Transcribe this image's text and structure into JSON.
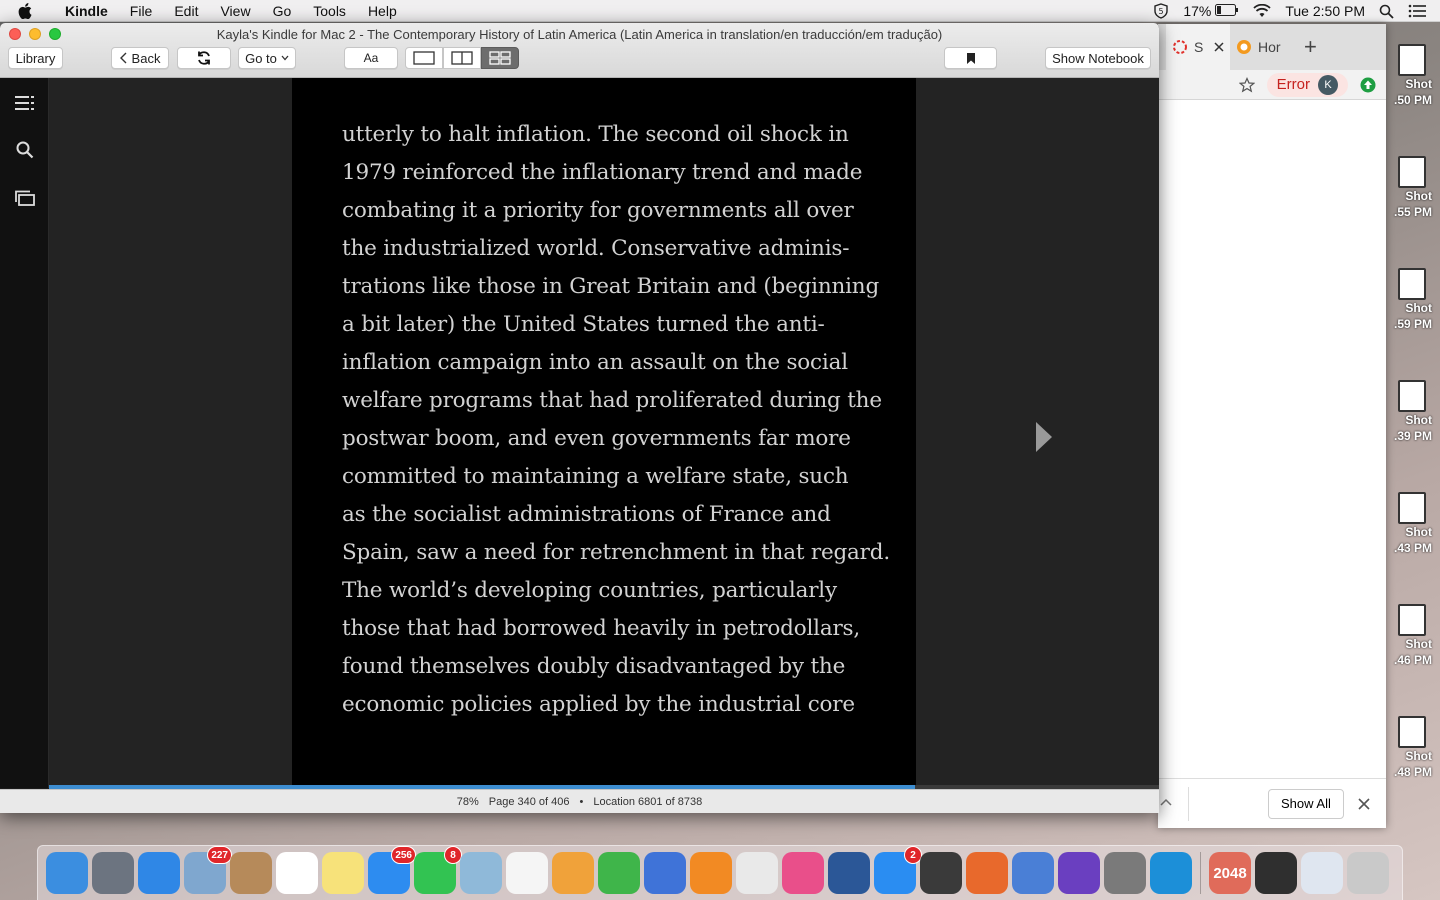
{
  "menubar": {
    "app": "Kindle",
    "menus": [
      "File",
      "Edit",
      "View",
      "Go",
      "Tools",
      "Help"
    ],
    "battery": "17%",
    "clock": "Tue 2:50 PM"
  },
  "desktop": {
    "thumbs": [
      {
        "line1": "Shot",
        "line2": ".50 PM"
      },
      {
        "line1": "Shot",
        "line2": ".55 PM"
      },
      {
        "line1": "Shot",
        "line2": ".59 PM"
      },
      {
        "line1": "Shot",
        "line2": ".39 PM"
      },
      {
        "line1": "Shot",
        "line2": ".43 PM"
      },
      {
        "line1": "Shot",
        "line2": ".46 PM"
      },
      {
        "line1": "Shot",
        "line2": ".48 PM"
      }
    ]
  },
  "chrome": {
    "tab1_label": "S",
    "tab2_label": "Hor",
    "new_tab": "+",
    "error_label": "Error",
    "avatar_letter": "K",
    "show_all": "Show All"
  },
  "kindle": {
    "title": "Kayla's Kindle for Mac 2 - The Contemporary History of Latin America (Latin America in translation/en traducción/em tradução)",
    "toolbar": {
      "library": "Library",
      "back": "Back",
      "goto": "Go to",
      "font": "Aa",
      "show_notebook": "Show Notebook"
    },
    "lines": [
      "utterly to halt inflation. The second oil shock in",
      "1979 reinforced the inflationary trend and made",
      "combating it a priority for governments all over",
      "the industrialized world. Conservative adminis-",
      "trations like those in Great Britain and (beginning",
      "a bit later) the United States turned the anti-",
      "inflation campaign into an assault on the social",
      "welfare programs that had proliferated during the",
      "postwar boom, and even governments far more",
      "committed to maintaining a welfare state, such",
      "as the socialist administrations of France and",
      "Spain, saw a need for retrenchment in that regard.",
      "The world’s developing countries, particularly",
      "those that had borrowed heavily in petrodollars,",
      "found themselves doubly disadvantaged by the",
      "economic policies applied by the industrial core"
    ],
    "progress_fraction": 0.78,
    "status": {
      "percent": "78%",
      "page": "Page 340 of 406",
      "location": "Location 6801 of 8738"
    }
  },
  "dock": {
    "items": [
      {
        "name": "finder",
        "color": "#3b8ee0",
        "badge": ""
      },
      {
        "name": "launchpad",
        "color": "#6c7480",
        "badge": ""
      },
      {
        "name": "safari",
        "color": "#2f87e6",
        "badge": ""
      },
      {
        "name": "mail",
        "color": "#7fa7cf",
        "badge": "227"
      },
      {
        "name": "contacts",
        "color": "#b68a5a",
        "badge": ""
      },
      {
        "name": "calendar",
        "color": "#ffffff",
        "badge": ""
      },
      {
        "name": "notes",
        "color": "#f7e27a",
        "badge": ""
      },
      {
        "name": "messages",
        "color": "#2d8cf0",
        "badge": "256"
      },
      {
        "name": "facetime",
        "color": "#32c352",
        "badge": "8"
      },
      {
        "name": "preview",
        "color": "#8fb9d9",
        "badge": ""
      },
      {
        "name": "photos",
        "color": "#f5f5f5",
        "badge": ""
      },
      {
        "name": "pages",
        "color": "#f0a23a",
        "badge": ""
      },
      {
        "name": "numbers",
        "color": "#3fb54a",
        "badge": ""
      },
      {
        "name": "keynote",
        "color": "#3f73d8",
        "badge": ""
      },
      {
        "name": "ibooks",
        "color": "#f28a23",
        "badge": ""
      },
      {
        "name": "chrome",
        "color": "#e9e9e9",
        "badge": ""
      },
      {
        "name": "itunes",
        "color": "#e94f8a",
        "badge": ""
      },
      {
        "name": "word",
        "color": "#2b5797",
        "badge": ""
      },
      {
        "name": "app-store",
        "color": "#2a8df2",
        "badge": "2"
      },
      {
        "name": "screen-recorder",
        "color": "#3a3a3a",
        "badge": ""
      },
      {
        "name": "firefox",
        "color": "#e8692c",
        "badge": ""
      },
      {
        "name": "bluetooth",
        "color": "#4a7fd6",
        "badge": ""
      },
      {
        "name": "imovie",
        "color": "#6a3fc0",
        "badge": ""
      },
      {
        "name": "calculator",
        "color": "#7a7a7a",
        "badge": ""
      },
      {
        "name": "kindle",
        "color": "#1c8fd8",
        "badge": ""
      }
    ],
    "right_items": [
      {
        "name": "game-2048",
        "label": "2048",
        "color": "#e06b5a"
      },
      {
        "name": "screen-window",
        "label": "",
        "color": "#2f2f2f"
      },
      {
        "name": "document-stack",
        "label": "",
        "color": "#dfe6f0"
      },
      {
        "name": "trash",
        "label": "",
        "color": "#c9c9c9"
      }
    ]
  }
}
